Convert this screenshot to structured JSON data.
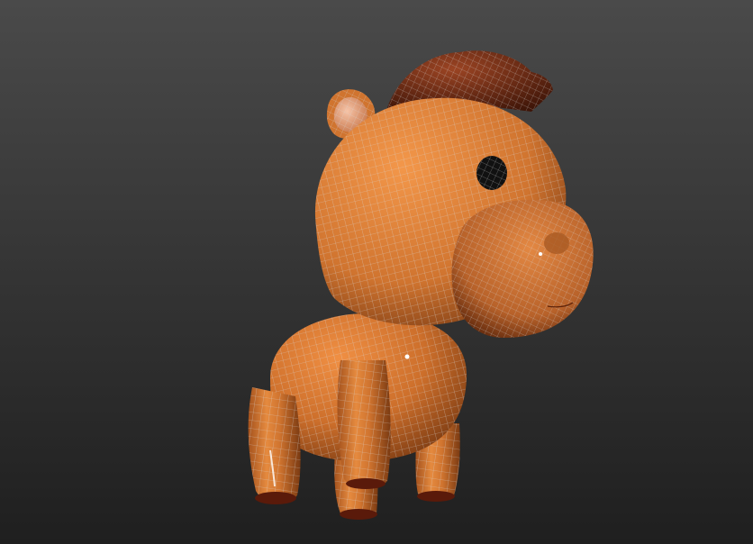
{
  "viewport": {
    "background_top": "#4a4a4a",
    "background_bottom": "#1f1f1f",
    "mode": "perspective",
    "shading": "smooth-highlights-edged-faces"
  },
  "model": {
    "subject": "cartoon-pony",
    "body_color": "#d0742f",
    "body_shadow": "#7a3a12",
    "mane_color": "#7a3214",
    "mane_shadow": "#3e1508",
    "inner_ear_color": "#f1b59a",
    "hoof_color": "#5a1a0a",
    "eye_color": "#101010",
    "wire_color": "#c9c9c9"
  }
}
